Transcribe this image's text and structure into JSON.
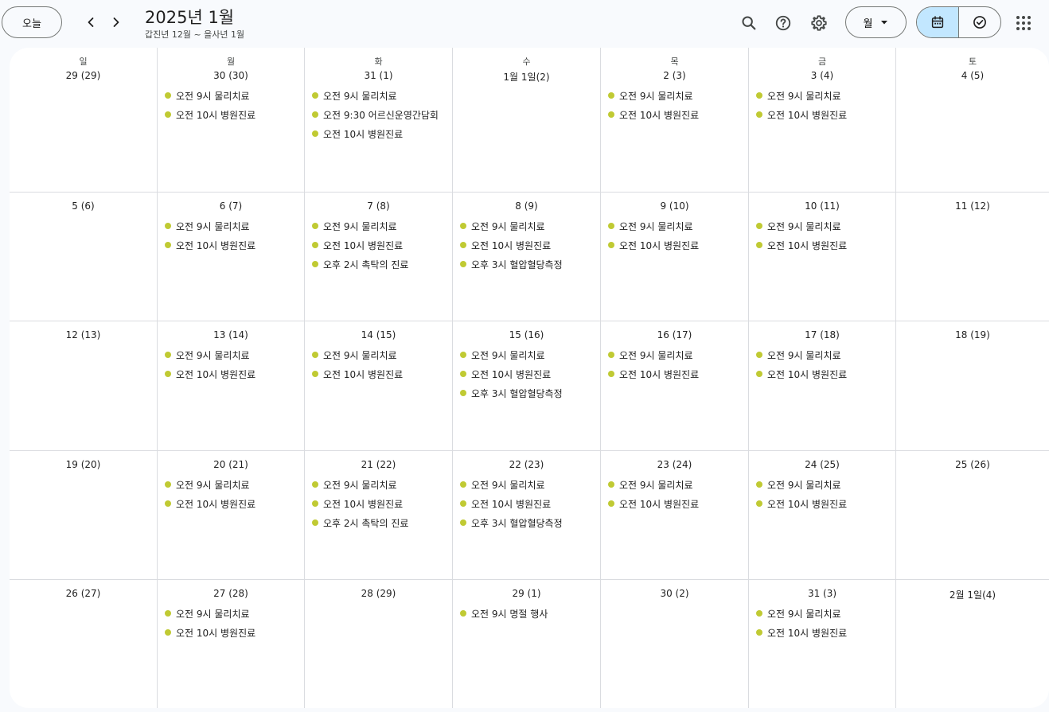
{
  "header": {
    "today_label": "오늘",
    "title": "2025년 1월",
    "subtitle": "갑진년 12월 ~ 을사년 1월",
    "view_label": "월"
  },
  "icons": {
    "prev": "chevron-left-icon",
    "next": "chevron-right-icon",
    "search": "search-icon",
    "help": "help-icon",
    "settings": "gear-icon",
    "dropdown": "caret-down-icon",
    "calendar_view": "calendar-icon",
    "tasks_view": "check-circle-icon",
    "apps": "apps-grid-icon"
  },
  "colors": {
    "event_dot": "#c0ca33",
    "active_toggle": "#c2e7ff",
    "background": "#f8fafd",
    "grid_line": "#dadce0"
  },
  "weekdays": [
    "일",
    "월",
    "화",
    "수",
    "목",
    "금",
    "토"
  ],
  "weeks": [
    [
      {
        "label": "29 (29)",
        "events": []
      },
      {
        "label": "30 (30)",
        "events": [
          "오전 9시 물리치료",
          "오전 10시 병원진료"
        ]
      },
      {
        "label": "31 (1)",
        "events": [
          "오전 9시 물리치료",
          "오전 9:30 어르신운영간담회",
          "오전 10시 병원진료"
        ]
      },
      {
        "label": "1월 1일(2)",
        "events": []
      },
      {
        "label": "2 (3)",
        "events": [
          "오전 9시 물리치료",
          "오전 10시 병원진료"
        ]
      },
      {
        "label": "3 (4)",
        "events": [
          "오전 9시 물리치료",
          "오전 10시 병원진료"
        ]
      },
      {
        "label": "4 (5)",
        "events": []
      }
    ],
    [
      {
        "label": "5 (6)",
        "events": []
      },
      {
        "label": "6 (7)",
        "events": [
          "오전 9시 물리치료",
          "오전 10시 병원진료"
        ]
      },
      {
        "label": "7 (8)",
        "events": [
          "오전 9시 물리치료",
          "오전 10시 병원진료",
          "오후 2시 촉탁의 진료"
        ]
      },
      {
        "label": "8 (9)",
        "events": [
          "오전 9시 물리치료",
          "오전 10시 병원진료",
          "오후 3시 혈압혈당측정"
        ]
      },
      {
        "label": "9 (10)",
        "events": [
          "오전 9시 물리치료",
          "오전 10시 병원진료"
        ]
      },
      {
        "label": "10 (11)",
        "events": [
          "오전 9시 물리치료",
          "오전 10시 병원진료"
        ]
      },
      {
        "label": "11 (12)",
        "events": []
      }
    ],
    [
      {
        "label": "12 (13)",
        "events": []
      },
      {
        "label": "13 (14)",
        "events": [
          "오전 9시 물리치료",
          "오전 10시 병원진료"
        ]
      },
      {
        "label": "14 (15)",
        "events": [
          "오전 9시 물리치료",
          "오전 10시 병원진료"
        ]
      },
      {
        "label": "15 (16)",
        "events": [
          "오전 9시 물리치료",
          "오전 10시 병원진료",
          "오후 3시 혈압혈당측정"
        ]
      },
      {
        "label": "16 (17)",
        "events": [
          "오전 9시 물리치료",
          "오전 10시 병원진료"
        ]
      },
      {
        "label": "17 (18)",
        "events": [
          "오전 9시 물리치료",
          "오전 10시 병원진료"
        ]
      },
      {
        "label": "18 (19)",
        "events": []
      }
    ],
    [
      {
        "label": "19 (20)",
        "events": []
      },
      {
        "label": "20 (21)",
        "events": [
          "오전 9시 물리치료",
          "오전 10시 병원진료"
        ]
      },
      {
        "label": "21 (22)",
        "events": [
          "오전 9시 물리치료",
          "오전 10시 병원진료",
          "오후 2시 촉탁의 진료"
        ]
      },
      {
        "label": "22 (23)",
        "events": [
          "오전 9시 물리치료",
          "오전 10시 병원진료",
          "오후 3시 혈압혈당측정"
        ]
      },
      {
        "label": "23 (24)",
        "events": [
          "오전 9시 물리치료",
          "오전 10시 병원진료"
        ]
      },
      {
        "label": "24 (25)",
        "events": [
          "오전 9시 물리치료",
          "오전 10시 병원진료"
        ]
      },
      {
        "label": "25 (26)",
        "events": []
      }
    ],
    [
      {
        "label": "26 (27)",
        "events": []
      },
      {
        "label": "27 (28)",
        "events": [
          "오전 9시 물리치료",
          "오전 10시 병원진료"
        ]
      },
      {
        "label": "28 (29)",
        "events": []
      },
      {
        "label": "29 (1)",
        "events": [
          "오전 9시 명절 행사"
        ]
      },
      {
        "label": "30 (2)",
        "events": []
      },
      {
        "label": "31 (3)",
        "events": [
          "오전 9시 물리치료",
          "오전 10시 병원진료"
        ]
      },
      {
        "label": "2월 1일(4)",
        "events": []
      }
    ]
  ]
}
